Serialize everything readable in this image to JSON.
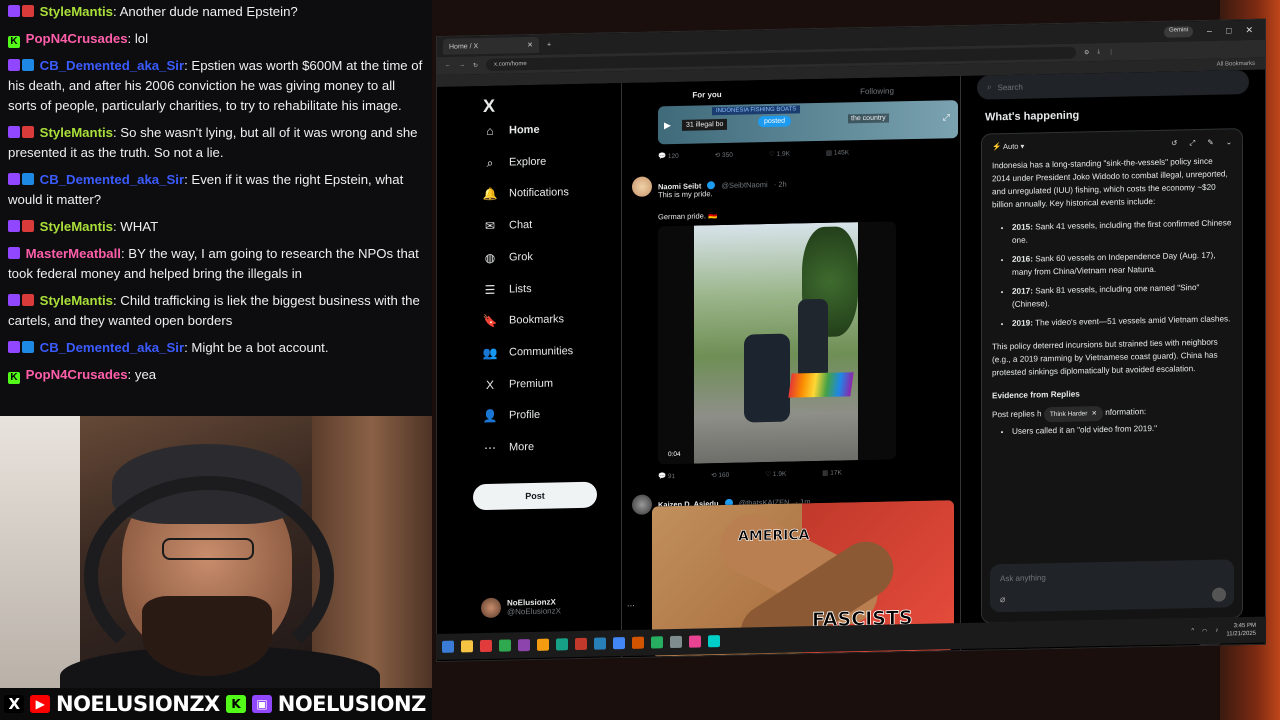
{
  "chat": {
    "messages": [
      {
        "user": "StyleMantis",
        "user_color": "#aadf3a",
        "text": "Another dude named Epstein?",
        "badge": "twitch-mod"
      },
      {
        "user": "PopN4Crusades",
        "user_color": "#ff5eaa",
        "text": "lol",
        "badge": "kick"
      },
      {
        "user": "CB_Demented_aka_Sir",
        "user_color": "#3b5bff",
        "text": "Epstien was worth $600M at the time of his death, and after his 2006 conviction he was giving money to all sorts of people, particularly charities, to try to rehabilitate his image.",
        "badge": "twitch-prime"
      },
      {
        "user": "StyleMantis",
        "user_color": "#aadf3a",
        "text": "So she wasn't lying, but all of it was wrong and she presented it as the truth. So not a lie.",
        "badge": "twitch-mod"
      },
      {
        "user": "CB_Demented_aka_Sir",
        "user_color": "#3b5bff",
        "text": "Even if it was the right Epstein, what would it matter?",
        "badge": "twitch-prime"
      },
      {
        "user": "StyleMantis",
        "user_color": "#aadf3a",
        "text": "WHAT",
        "badge": "twitch-mod"
      },
      {
        "user": "MasterMeatball",
        "user_color": "#ff5eaa",
        "text": "BY the way, I am going to research the NPOs that took federal money and helped bring the illegals in",
        "badge": "twitch"
      },
      {
        "user": "StyleMantis",
        "user_color": "#aadf3a",
        "text": "Child trafficking is liek the biggest business with the cartels, and they wanted open borders",
        "badge": "twitch-mod"
      },
      {
        "user": "CB_Demented_aka_Sir",
        "user_color": "#3b5bff",
        "text": "Might be a bot account.",
        "badge": "twitch-prime"
      },
      {
        "user": "PopN4Crusades",
        "user_color": "#ff5eaa",
        "text": "yea",
        "badge": "kick"
      }
    ]
  },
  "banner": {
    "handle_x": "NOELUSIONZX",
    "handle_twitch": "NOELUSIONZ",
    "kick_icon": "K",
    "x_icon": "X",
    "youtube_icon": "▶"
  },
  "browser": {
    "tab_title": "Home / X",
    "new_tab": "+",
    "gemini": "Gemini",
    "url": "x.com/home",
    "all_bookmarks": "All Bookmarks",
    "win_min": "–",
    "win_max": "□",
    "win_close": "✕"
  },
  "nav": {
    "logo": "X",
    "items": [
      {
        "label": "Home",
        "icon": "home-icon",
        "glyph": "⌂"
      },
      {
        "label": "Explore",
        "icon": "search-icon",
        "glyph": "⌕"
      },
      {
        "label": "Notifications",
        "icon": "bell-icon",
        "glyph": "🔔"
      },
      {
        "label": "Chat",
        "icon": "mail-icon",
        "glyph": "✉"
      },
      {
        "label": "Grok",
        "icon": "grok-icon",
        "glyph": "◍"
      },
      {
        "label": "Lists",
        "icon": "list-icon",
        "glyph": "☰"
      },
      {
        "label": "Bookmarks",
        "icon": "bookmark-icon",
        "glyph": "🔖"
      },
      {
        "label": "Communities",
        "icon": "people-icon",
        "glyph": "👥"
      },
      {
        "label": "Premium",
        "icon": "x-icon",
        "glyph": "X"
      },
      {
        "label": "Profile",
        "icon": "person-icon",
        "glyph": "👤"
      },
      {
        "label": "More",
        "icon": "more-icon",
        "glyph": "⋯"
      }
    ],
    "post_label": "Post",
    "account_name": "NoElusionzX",
    "account_handle": "@NoElusionzX",
    "account_more": "···"
  },
  "feed": {
    "tabs": [
      "For you",
      "Following"
    ],
    "video1": {
      "tag": "INDONESIA FISHING BOATS",
      "caption": "31 illegal bo",
      "caption2": "the country",
      "posted": "posted"
    },
    "tweet1_engage": {
      "replies": "120",
      "reposts": "350",
      "likes": "1.9K",
      "views": "145K"
    },
    "tweet2": {
      "name": "Naomi Seibt",
      "handle": "@SeibtNaomi",
      "time": "· 2h",
      "text1": "This is my pride.",
      "text2": "German pride. 🇩🇪",
      "video_time": "0:04",
      "replies": "91",
      "reposts": "160",
      "likes": "1.9K",
      "views": "17K"
    },
    "tweet3": {
      "name": "Kaizen D. Asiedu",
      "handle": "@thatsKAIZEN",
      "time": "· 1m",
      "meme_top": "AMERICA",
      "meme_bottom": "FASCISTS"
    }
  },
  "right": {
    "search_placeholder": "Search",
    "whats_happening": "What's happening",
    "grok_mode": "Auto",
    "grok_p1": "Indonesia has a long-standing \"sink-the-vessels\" policy since 2014 under President Joko Widodo to combat illegal, unreported, and unregulated (IUU) fishing, which costs the economy ~$20 billion annually. Key historical events include:",
    "grok_list": [
      {
        "year": "2015:",
        "text": " Sank 41 vessels, including the first confirmed Chinese one."
      },
      {
        "year": "2016:",
        "text": " Sank 60 vessels on Independence Day (Aug. 17), many from China/Vietnam near Natuna."
      },
      {
        "year": "2017:",
        "text": " Sank 81 vessels, including one named \"Sino\" (Chinese)."
      },
      {
        "year": "2019:",
        "text": " The video's event—51 vessels amid Vietnam clashes."
      }
    ],
    "grok_p2": "This policy deterred incursions but strained ties with neighbors (e.g., a 2019 ramming by Vietnamese coast guard). China has protested sinkings diplomatically but avoided escalation.",
    "grok_h": "Evidence from Replies",
    "grok_p3": "Post replies h",
    "grok_p3b": "nformation:",
    "think_harder": "Think Harder",
    "grok_bullet": "Users called it an \"old video from 2019.\"",
    "ask_placeholder": "Ask anything"
  },
  "taskbar": {
    "time": "3:45 PM",
    "date": "11/21/2025"
  }
}
